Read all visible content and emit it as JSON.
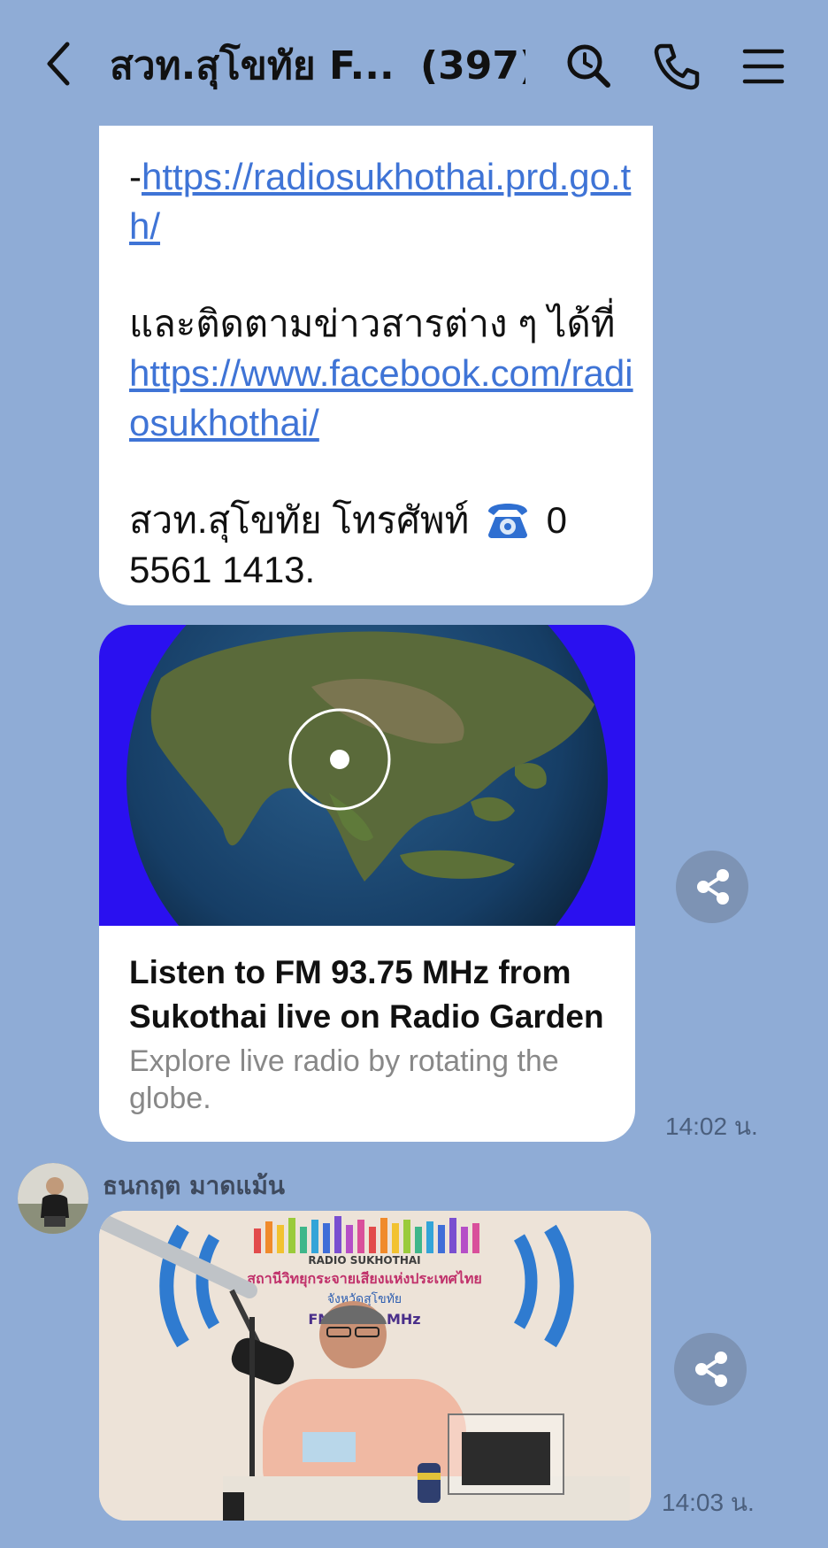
{
  "header": {
    "title": "สวท.สุโขทัย F...",
    "member_count": "(397)",
    "icons": [
      "back-arrow-icon",
      "search-icon",
      "phone-icon",
      "menu-icon"
    ]
  },
  "message1": {
    "dash": "-",
    "link1": "https://radiosukhothai.prd.go.th/",
    "follow_text": "และติดตามข่าวสารต่าง ๆ ได้ที่",
    "link2": "https://www.facebook.com/radiosukhothai/",
    "contact_text": "สวท.สุโขทัย โทรศัพท์",
    "phone_icon": "telephone-emoji",
    "phone_number": "0 5561 1413."
  },
  "link_card": {
    "image": "globe-map",
    "title": "Listen to FM 93.75 MHz from Sukothai live on Radio Garden",
    "description": "Explore live radio by rotating the globe.",
    "time": "14:02 น."
  },
  "message2": {
    "sender": "ธนกฤต มาดแม้น",
    "image": "radio-studio-photo",
    "banner_top": "RADIO SUKHOTHAI",
    "banner_name": "สถานีวิทยุกระจายเสียงแห่งประเทศไทย",
    "banner_province": "จังหวัดสุโขทัย",
    "banner_freq": "FM 93.75 MHz",
    "time": "14:03 น."
  },
  "colors": {
    "background": "#8facd6",
    "link": "#3f74d6",
    "share_button": "#7d93b4"
  }
}
